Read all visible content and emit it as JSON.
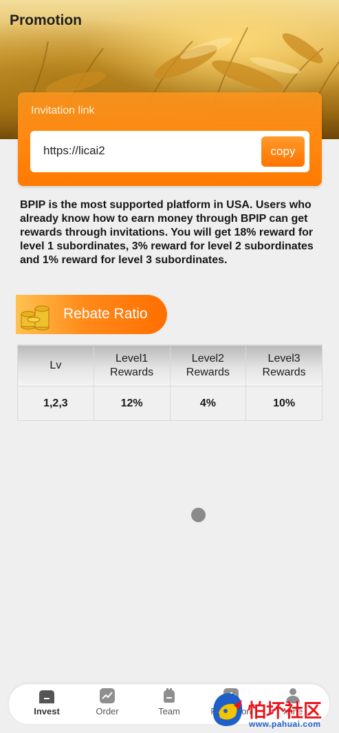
{
  "header": {
    "title": "Promotion"
  },
  "invite": {
    "label": "Invitation link",
    "link": "https://licai2",
    "copy_label": "copy"
  },
  "description": "BPIP is the most supported platform in USA. Users who already know how to earn money through BPIP can get rewards through invitations. You will get 18% reward for level 1 subordinates, 3% reward for level 2 subordinates and 1% reward for level 3 subordinates.",
  "rebate": {
    "title": "Rebate Ratio",
    "headers": [
      "Lv",
      "Level1\nRewards",
      "Level2\nRewards",
      "Level3\nRewards"
    ],
    "header_lines": [
      [
        "Lv"
      ],
      [
        "Level1",
        "Rewards"
      ],
      [
        "Level2",
        "Rewards"
      ],
      [
        "Level3",
        "Rewards"
      ]
    ],
    "rows": [
      [
        "1,2,3",
        "12%",
        "4%",
        "10%"
      ]
    ]
  },
  "nav": {
    "items": [
      {
        "label": "Invest",
        "icon": "home-icon",
        "active": true
      },
      {
        "label": "Order",
        "icon": "chart-icon",
        "active": false
      },
      {
        "label": "Team",
        "icon": "team-icon",
        "active": false
      },
      {
        "label": "Promotion",
        "icon": "bar-chart-icon",
        "active": false
      },
      {
        "label": "Mine",
        "icon": "user-icon",
        "active": false
      }
    ]
  },
  "watermark": {
    "text": "怕坏社区",
    "url": "www.pahuai.com"
  },
  "colors": {
    "accent": "#ff7a00",
    "background": "#efefef"
  }
}
